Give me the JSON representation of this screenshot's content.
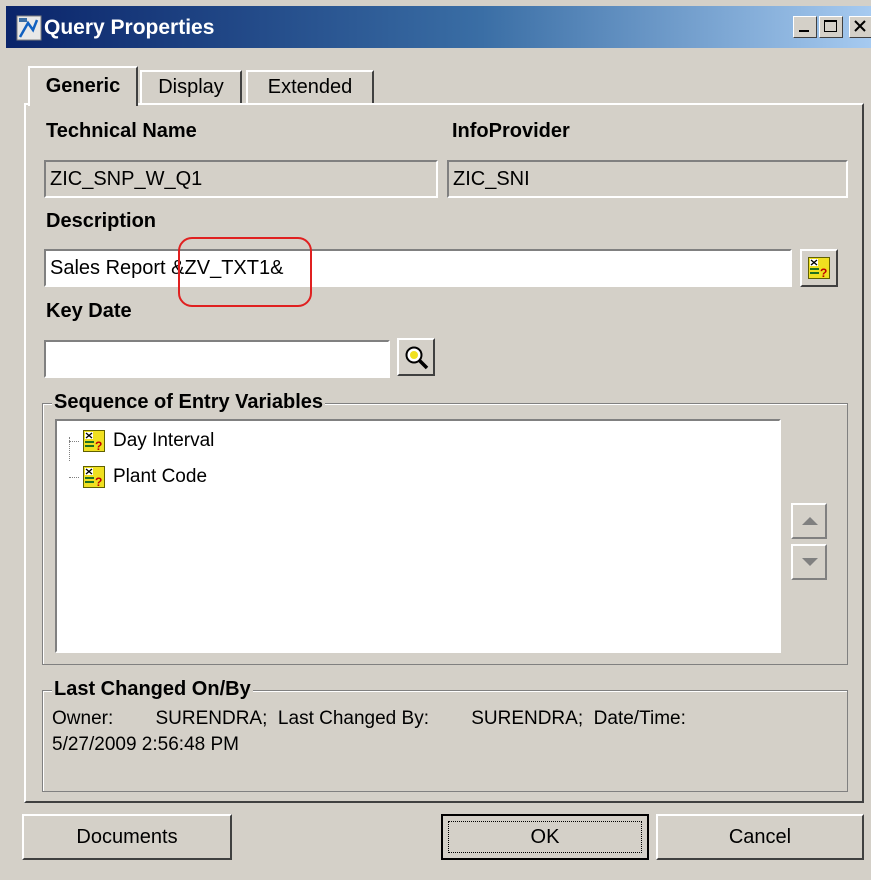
{
  "window": {
    "title": "Query Properties",
    "accent_color": "#0a246a"
  },
  "tabs": [
    {
      "label": "Generic",
      "active": true
    },
    {
      "label": "Display",
      "active": false
    },
    {
      "label": "Extended",
      "active": false
    }
  ],
  "generic": {
    "technical_name_label": "Technical Name",
    "technical_name_value": "ZIC_SNP_W_Q1",
    "infoprovider_label": "InfoProvider",
    "infoprovider_value": "ZIC_SNI",
    "description_label": "Description",
    "description_value": "Sales Report &ZV_TXT1&",
    "key_date_label": "Key Date",
    "key_date_value": ""
  },
  "entry_variables": {
    "title": "Sequence of Entry Variables",
    "items": [
      {
        "label": "Day Interval",
        "icon": "variable-icon"
      },
      {
        "label": "Plant Code",
        "icon": "variable-icon"
      }
    ]
  },
  "last_changed": {
    "title": "Last Changed On/By",
    "line1": "Owner:        SURENDRA;  Last Changed By:        SURENDRA;  Date/Time:",
    "line2": "5/27/2009 2:56:48 PM"
  },
  "buttons": {
    "documents": "Documents",
    "ok": "OK",
    "cancel": "Cancel"
  }
}
